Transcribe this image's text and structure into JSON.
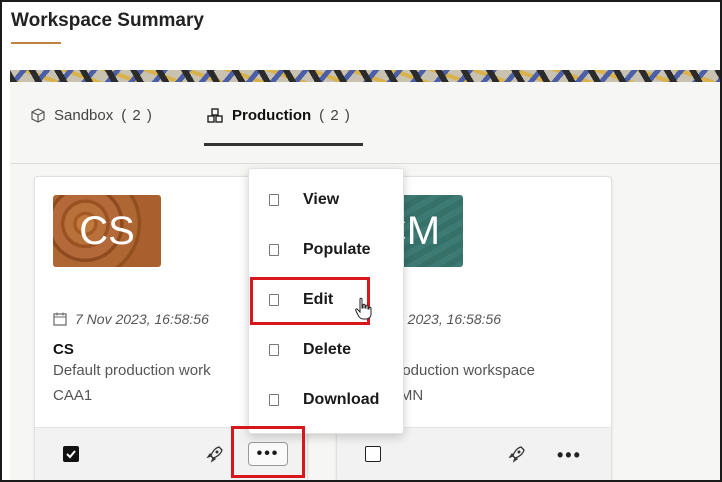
{
  "page": {
    "title": "Workspace Summary"
  },
  "tabs": [
    {
      "label": "Sandbox",
      "count": "( 2 )",
      "icon": "cube-icon"
    },
    {
      "label": "Production",
      "count": "( 2 )",
      "icon": "cubes-icon"
    }
  ],
  "cards": [
    {
      "initials": "CS",
      "date": "7 Nov 2023, 16:58:56",
      "name": "CS",
      "description": "Default production work",
      "code": "CAA1",
      "checked": true
    },
    {
      "initials": "CM",
      "date": "ov 2023, 16:58:56",
      "name": "",
      "description": "production workspace",
      "code": "DMN",
      "checked": false
    }
  ],
  "menu": {
    "items": [
      {
        "label": "View"
      },
      {
        "label": "Populate"
      },
      {
        "label": "Edit"
      },
      {
        "label": "Delete"
      },
      {
        "label": "Download"
      }
    ]
  },
  "more_label": "•••",
  "colors": {
    "accent": "#c0813d",
    "highlight": "#d9161c"
  }
}
